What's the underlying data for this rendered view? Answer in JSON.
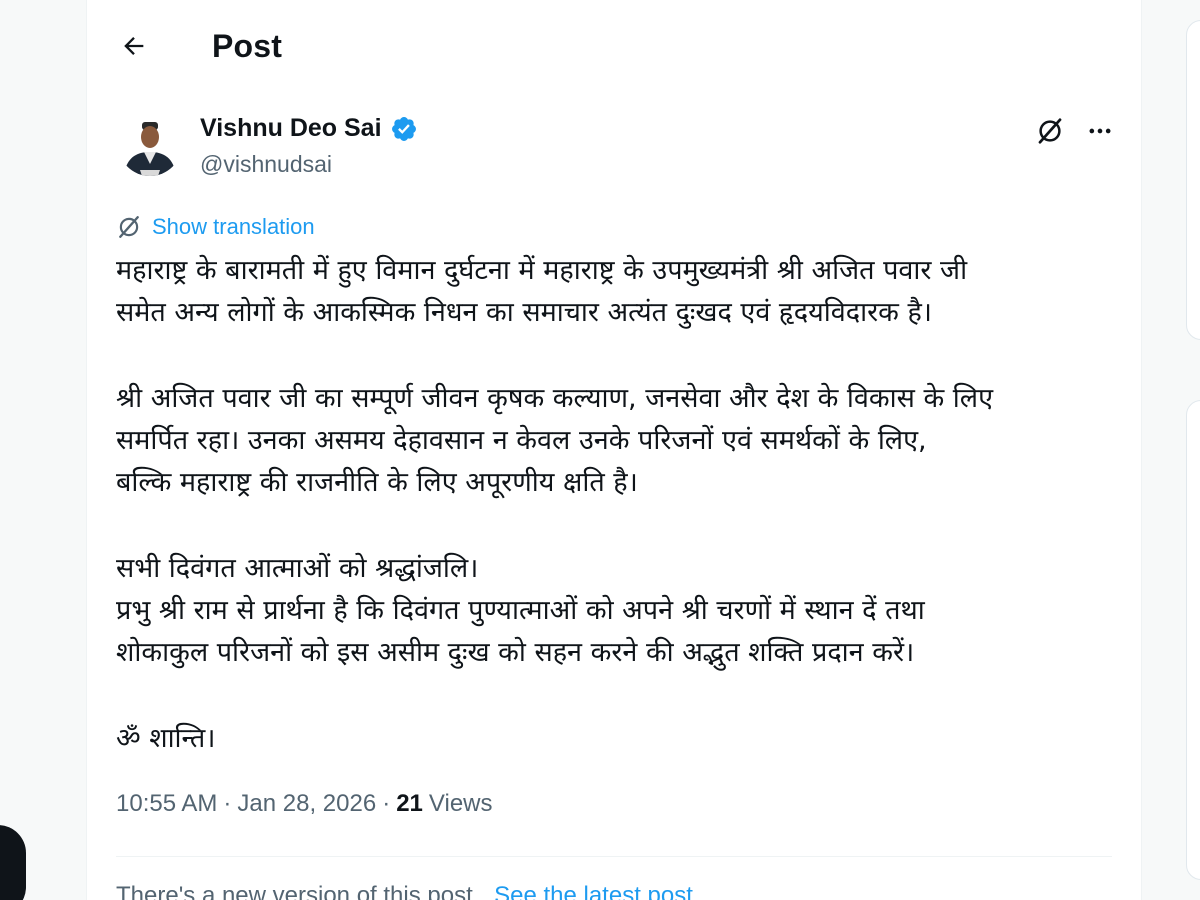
{
  "header": {
    "title": "Post"
  },
  "author": {
    "name": "Vishnu Deo Sai",
    "handle": "@vishnudsai",
    "verified_color": "#1d9bf0"
  },
  "translate": {
    "label": "Show translation"
  },
  "post": {
    "p1": [
      "महाराष्ट्र के बारामती में हुए विमान दुर्घटना में महाराष्ट्र के उपमुख्यमंत्री श्री अजित पवार जी",
      "समेत अन्य लोगों के आकस्मिक निधन का समाचार अत्यंत दुःखद एवं हृदयविदारक है।"
    ],
    "p2": [
      "श्री अजित पवार जी का सम्पूर्ण जीवन कृषक कल्याण, जनसेवा और देश के विकास के लिए",
      "समर्पित रहा। उनका असमय देहावसान न केवल उनके परिजनों एवं समर्थकों के लिए,",
      "बल्कि महाराष्ट्र की राजनीति के लिए अपूरणीय क्षति है।"
    ],
    "p3": [
      "सभी दिवंगत आत्माओं को श्रद्धांजलि।",
      "प्रभु श्री राम से प्रार्थना है कि दिवंगत पुण्यात्माओं को अपने श्री चरणों में स्थान दें तथा",
      "शोकाकुल परिजनों को इस असीम दुःख को सहन करने की अद्भुत शक्ति प्रदान करें।"
    ],
    "p4": [
      "ॐ शान्ति।"
    ]
  },
  "meta": {
    "time": "10:55 AM",
    "date": "Jan 28, 2026",
    "views_count": "21",
    "views_label": "Views"
  },
  "notice": {
    "text": "There's a new version of this post.",
    "link": "See the latest post"
  },
  "colors": {
    "accent": "#1d9bf0",
    "secondary_text": "#536471",
    "primary_text": "#0f1419"
  },
  "icons": {
    "back": "arrow-left-icon",
    "grok": "grok-icon",
    "more": "more-horizontal-icon",
    "translate": "translate-icon",
    "verified": "verified-badge-icon"
  }
}
